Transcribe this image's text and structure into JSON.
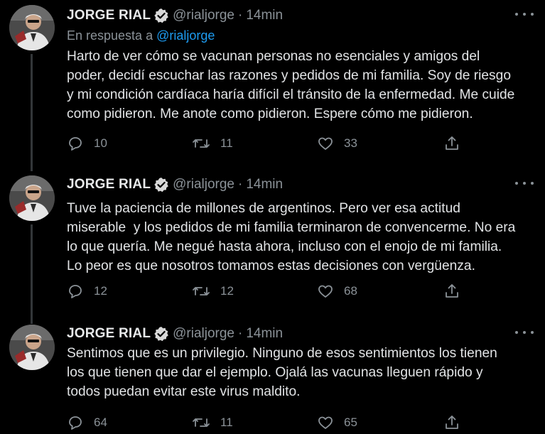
{
  "colors": {
    "background": "#000000",
    "text": "#e1e3e5",
    "muted": "#8b9298",
    "accent": "#1d9bf0",
    "thread_line": "#333639"
  },
  "icons": {
    "verified": "verified-badge-icon",
    "more": "more-horizontal-icon",
    "reply": "reply-bubble-icon",
    "retweet": "retweet-arrows-icon",
    "like": "heart-outline-icon",
    "share": "share-upload-icon"
  },
  "tweets": [
    {
      "name": "JORGE RIAL",
      "handle": "@rialjorge",
      "separator": "·",
      "time": "14min",
      "reply_prefix": "En respuesta a",
      "reply_to": "@rialjorge",
      "lines": [
        "Harto de ver cómo se vacunan personas no esenciales y amigos del",
        "poder, decidí escuchar las razones y pedidos de mi familia. Soy de riesgo",
        "y mi condición cardíaca haría difícil el tránsito de la enfermedad. Me cuide",
        "como pidieron. Me anote como pidieron. Espere cómo me pidieron."
      ],
      "replies": "10",
      "retweets": "11",
      "likes": "33"
    },
    {
      "name": "JORGE RIAL",
      "handle": "@rialjorge",
      "separator": "·",
      "time": "14min",
      "lines": [
        "Tuve la paciencia de millones de argentinos. Pero ver esa actitud",
        "miserable  y los pedidos de mi familia terminaron de convencerme. No era",
        "lo que quería. Me negué hasta ahora, incluso con el enojo de mi familia.",
        "Lo peor es que nosotros tomamos estas decisiones con vergüenza."
      ],
      "replies": "12",
      "retweets": "12",
      "likes": "68"
    },
    {
      "name": "JORGE RIAL",
      "handle": "@rialjorge",
      "separator": "·",
      "time": "14min",
      "lines": [
        "Sentimos que es un privilegio. Ninguno de esos sentimientos los tienen",
        "los que tienen que dar el ejemplo. Ojalá las vacunas lleguen rápido y",
        "todos puedan evitar este virus maldito."
      ],
      "replies": "64",
      "retweets": "11",
      "likes": "65"
    }
  ]
}
